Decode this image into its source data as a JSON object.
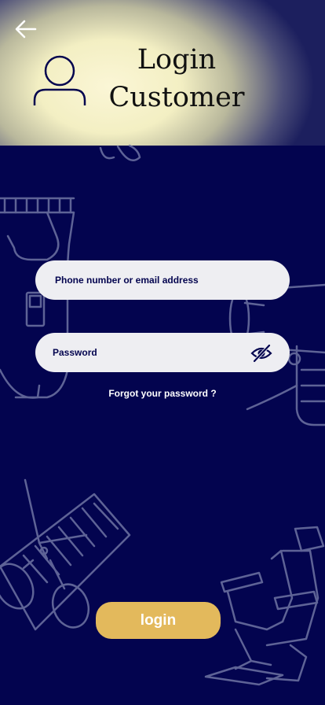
{
  "header": {
    "title_line1": "Login",
    "title_line2": "Customer",
    "back_icon": "arrow-left-icon",
    "avatar_icon": "user-icon"
  },
  "form": {
    "phone_placeholder": "Phone number or email address",
    "phone_value": "",
    "password_placeholder": "Password",
    "password_value": "",
    "password_toggle_icon": "eye-off-icon",
    "forgot_label": "Forgot your password ?"
  },
  "actions": {
    "login_label": "login"
  },
  "colors": {
    "background": "#03044f",
    "accent": "#e3b95c",
    "field_background": "#eeeef2",
    "art_stroke": "#6f74a3"
  },
  "decorations": [
    "hair-clipper-icon",
    "hair-dryer-icon",
    "scissors-icon",
    "comb-icon",
    "barber-chair-icon"
  ]
}
